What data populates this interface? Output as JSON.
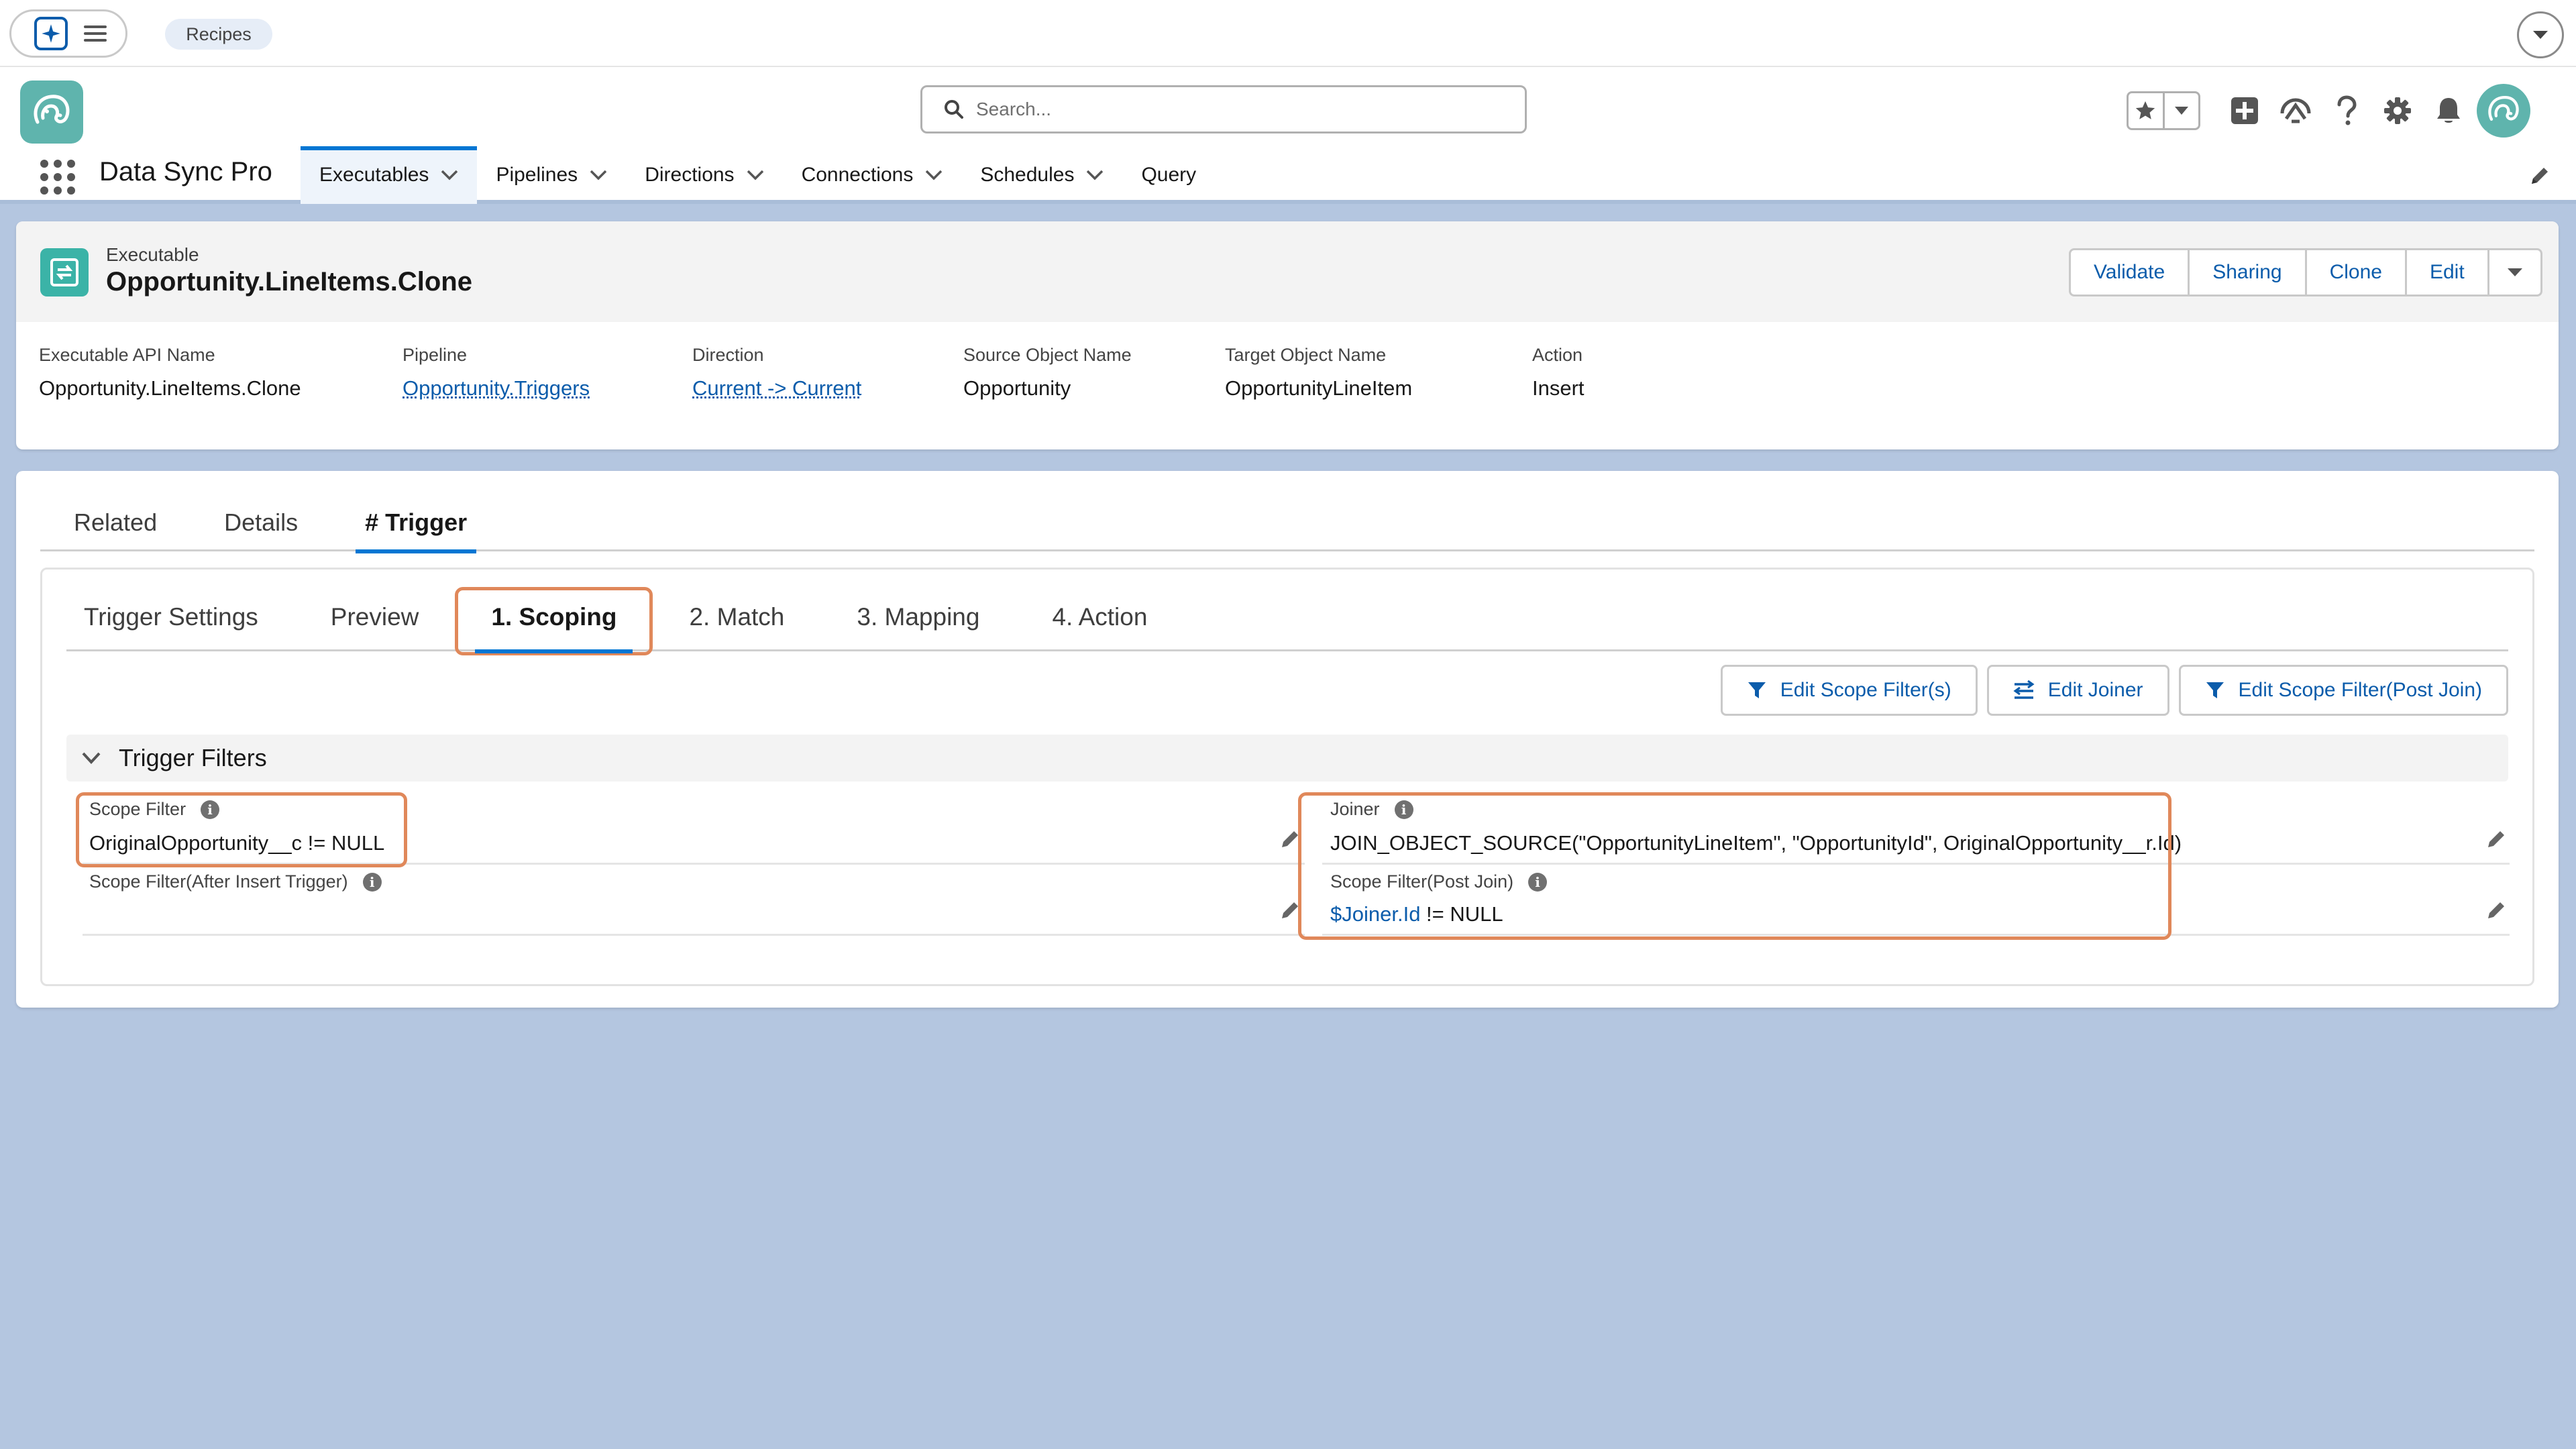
{
  "topbar": {
    "recipes_label": "Recipes"
  },
  "header": {
    "search_placeholder": "Search...",
    "app_name": "Data Sync Pro",
    "nav": [
      {
        "label": "Executables",
        "has_menu": true,
        "active": true
      },
      {
        "label": "Pipelines",
        "has_menu": true
      },
      {
        "label": "Directions",
        "has_menu": true
      },
      {
        "label": "Connections",
        "has_menu": true
      },
      {
        "label": "Schedules",
        "has_menu": true
      },
      {
        "label": "Query",
        "has_menu": false
      }
    ]
  },
  "record": {
    "object_type": "Executable",
    "title": "Opportunity.LineItems.Clone",
    "buttons": [
      "Validate",
      "Sharing",
      "Clone",
      "Edit"
    ],
    "fields": [
      {
        "label": "Executable API Name",
        "value": "Opportunity.LineItems.Clone",
        "link": false
      },
      {
        "label": "Pipeline",
        "value": "Opportunity.Triggers",
        "link": true
      },
      {
        "label": "Direction",
        "value": "Current -> Current",
        "link": true
      },
      {
        "label": "Source Object Name",
        "value": "Opportunity",
        "link": false
      },
      {
        "label": "Target Object Name",
        "value": "OpportunityLineItem",
        "link": false
      },
      {
        "label": "Action",
        "value": "Insert",
        "link": false
      }
    ]
  },
  "tabs": [
    {
      "label": "Related"
    },
    {
      "label": "Details"
    },
    {
      "label": "# Trigger",
      "active": true
    }
  ],
  "trigger": {
    "subtabs": [
      {
        "label": "Trigger Settings"
      },
      {
        "label": "Preview"
      },
      {
        "label": "1. Scoping",
        "active": true
      },
      {
        "label": "2. Match"
      },
      {
        "label": "3. Mapping"
      },
      {
        "label": "4. Action"
      }
    ],
    "actions": [
      {
        "label": "Edit Scope Filter(s)",
        "icon": "filter-icon"
      },
      {
        "label": "Edit Joiner",
        "icon": "joiner-icon"
      },
      {
        "label": "Edit Scope Filter(Post Join)",
        "icon": "filter-icon"
      }
    ],
    "section_title": "Trigger Filters",
    "scope_filter": {
      "label": "Scope Filter",
      "value": "OriginalOpportunity__c != NULL"
    },
    "scope_filter_after_insert": {
      "label": "Scope Filter(After Insert Trigger)",
      "value": ""
    },
    "joiner": {
      "label": "Joiner",
      "value": "JOIN_OBJECT_SOURCE(\"OpportunityLineItem\", \"OpportunityId\", OriginalOpportunity__r.Id)"
    },
    "scope_filter_post_join": {
      "label": "Scope Filter(Post Join)",
      "value_token": "$Joiner.Id",
      "value_rest": " != NULL"
    }
  },
  "colors": {
    "brand_blue": "#0176d3",
    "link_blue": "#0b5cab",
    "highlight_orange": "#e0885a",
    "page_background": "#b4c6e0",
    "logo_teal": "#5fb4ad"
  }
}
